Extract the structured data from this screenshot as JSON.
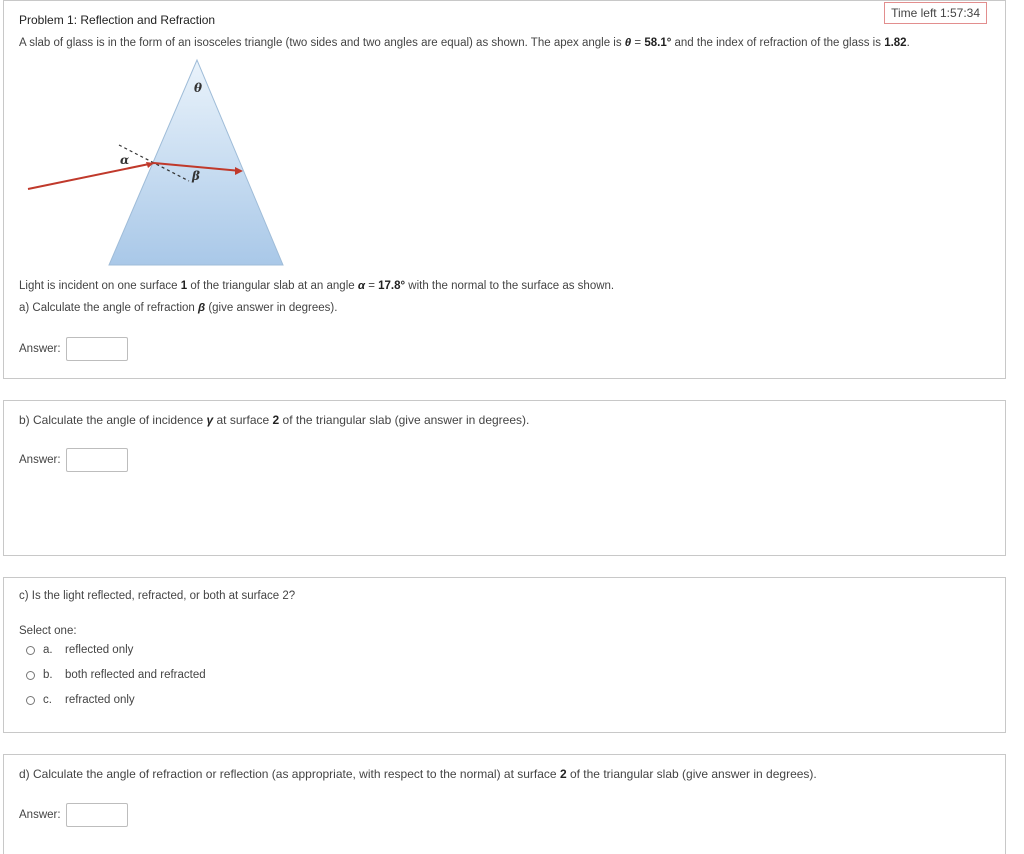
{
  "timer": {
    "label": "Time left 1:57:34"
  },
  "q1": {
    "title": "Problem 1: Reflection and Refraction",
    "intro_pre": "A slab of glass is in the form of an isosceles triangle (two sides and two angles are equal) as shown. The apex angle is ",
    "theta_sym": "θ",
    "intro_mid1": " = ",
    "theta_val": "58.1°",
    "intro_mid2": " and the index of refraction of the glass is ",
    "index_val": "1.82",
    "intro_end": ".",
    "diagram": {
      "theta_label": "θ",
      "alpha_label": "α",
      "beta_label": "β"
    },
    "line2_pre": "Light is incident on one surface ",
    "surface1": "1",
    "line2_mid": " of the triangular slab at an angle ",
    "alpha_sym": "α",
    "line2_eq": " = ",
    "alpha_val": "17.8°",
    "line2_end": " with the normal to the surface as shown.",
    "qa_pre": "a) Calculate the angle of refraction ",
    "beta_sym": "β",
    "qa_end": " (give answer in degrees).",
    "answer_label": "Answer:"
  },
  "q2": {
    "text_pre": "b) Calculate the angle of incidence ",
    "gamma_sym": "γ",
    "text_mid": " at surface ",
    "surface2": "2",
    "text_end": " of the triangular slab (give answer in degrees).",
    "answer_label": "Answer:"
  },
  "q3": {
    "text": "c) Is the light reflected, refracted, or both at surface 2?",
    "select_label": "Select one:",
    "options": [
      {
        "letter": "a.",
        "label": "reflected only"
      },
      {
        "letter": "b.",
        "label": "both reflected and refracted"
      },
      {
        "letter": "c.",
        "label": "refracted only"
      }
    ]
  },
  "q4": {
    "text_pre": "d) Calculate the angle of refraction or reflection (as appropriate, with respect to the normal) at surface ",
    "surface2": "2",
    "text_end": " of the triangular slab (give answer in degrees).",
    "answer_label": "Answer:"
  },
  "colors": {
    "ray": "#c0392b",
    "glass_top": "#eaf3fb",
    "glass_bottom": "#a9c8e8",
    "timer_border": "#e28e8e"
  }
}
